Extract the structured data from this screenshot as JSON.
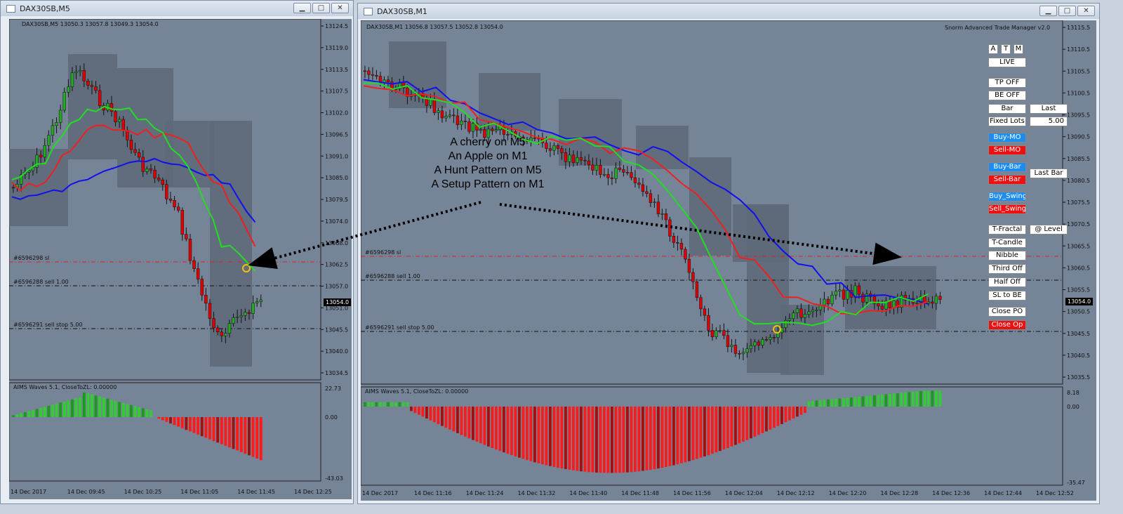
{
  "left_window": {
    "title": "DAX30SB,M5",
    "info": "DAX30SB,M5  13050.3 13057.8 13049.3 13054.0",
    "price_ticks": [
      "13124.5",
      "13119.0",
      "13113.5",
      "13107.5",
      "13102.0",
      "13096.5",
      "13091.0",
      "13085.0",
      "13079.5",
      "13074.0",
      "13068.0",
      "13062.5",
      "13057.0",
      "13051.0",
      "13045.5",
      "13040.0",
      "13034.5"
    ],
    "current_price": "13054.0",
    "order_lines": [
      "#6596298 sl",
      "#6596288 sell 1.00",
      "#6596291 sell stop 5.00"
    ],
    "indicator_title": "AIMS Waves 5.1, CloseToZL: 0.00000",
    "indicator_ticks": [
      "22.73",
      "0.00",
      "-43.03"
    ],
    "time_ticks": [
      "14 Dec 2017",
      "14 Dec 09:45",
      "14 Dec 10:25",
      "14 Dec 11:05",
      "14 Dec 11:45",
      "14 Dec 12:25"
    ]
  },
  "right_window": {
    "title": "DAX30SB,M1",
    "info": "DAX30SB,M1  13056.8 13057.5 13052.8 13054.0",
    "manager_title": "Snorm Advanced Trade Manager v2.0",
    "price_ticks": [
      "13115.5",
      "13110.5",
      "13105.5",
      "13100.5",
      "13095.5",
      "13090.5",
      "13085.5",
      "13080.5",
      "13075.5",
      "13070.5",
      "13065.5",
      "13060.5",
      "13055.5",
      "13050.5",
      "13045.5",
      "13040.5",
      "13035.5"
    ],
    "current_price": "13054.0",
    "order_lines": [
      "#6596298 sl",
      "#6596288 sell 1.00",
      "#6596291 sell stop 5.00"
    ],
    "indicator_title": "AIMS Waves 5.1, CloseToZL: 0.00000",
    "indicator_ticks": [
      "8.18",
      "0.00",
      "-35.47"
    ],
    "time_ticks": [
      "14 Dec 2017",
      "14 Dec 11:16",
      "14 Dec 11:24",
      "14 Dec 11:32",
      "14 Dec 11:40",
      "14 Dec 11:48",
      "14 Dec 11:56",
      "14 Dec 12:04",
      "14 Dec 12:12",
      "14 Dec 12:20",
      "14 Dec 12:28",
      "14 Dec 12:36",
      "14 Dec 12:44",
      "14 Dec 12:52"
    ]
  },
  "annotation": {
    "line1": "A cherry on M5",
    "line2": "An Apple on M1",
    "line3": "A Hunt Pattern on M5",
    "line4": "A Setup Pattern on M1"
  },
  "trade_manager": {
    "a": "A",
    "t": "T",
    "m": "M",
    "live": "LIVE",
    "tp_off": "TP OFF",
    "be_off": "BE OFF",
    "bar": "Bar",
    "last": "Last",
    "fixed_lots": "Fixed Lots",
    "lots_value": "5.00",
    "buy_mo": "Buy-MO",
    "sell_mo": "Sell-MO",
    "buy_bar": "Buy-Bar",
    "sell_bar": "Sell-Bar",
    "last_bar": "Last Bar",
    "buy_swing": "Buy_Swing",
    "sell_swing": "Sell_Swing",
    "t_fractal": "T-Fractal",
    "at_level": "@ Level",
    "t_candle": "T-Candle",
    "nibble": "Nibble",
    "third_off": "Third Off",
    "half_off": "Half Off",
    "sl_to_be": "SL to BE",
    "close_po": "Close PO",
    "close_op": "Close Op"
  },
  "colors": {
    "chart_bg": "#768498",
    "bull": "#22aa22",
    "bear": "#e00000",
    "ma_fast": "#22dd22",
    "ma_mid": "#ee2020",
    "ma_slow": "#1010ee",
    "box": "#5e6978"
  }
}
